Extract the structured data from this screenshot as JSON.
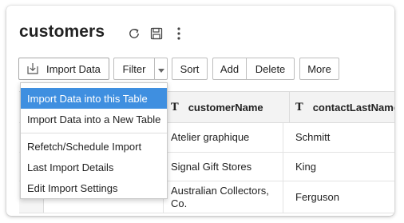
{
  "page": {
    "title": "customers"
  },
  "title_icons": [
    "refresh-icon",
    "save-icon",
    "more-vertical-icon"
  ],
  "toolbar": {
    "import_label": "Import Data",
    "filter_label": "Filter",
    "sort_label": "Sort",
    "add_label": "Add",
    "delete_label": "Delete",
    "more_label": "More"
  },
  "import_menu": {
    "items": [
      {
        "label": "Import Data into this Table",
        "active": true
      },
      {
        "label": "Import Data into a New Table",
        "active": false
      },
      {
        "label": "Refetch/Schedule Import",
        "active": false
      },
      {
        "label": "Last Import Details",
        "active": false
      },
      {
        "label": "Edit Import Settings",
        "active": false
      }
    ]
  },
  "table": {
    "columns": [
      {
        "type_glyph": "T",
        "name": "customerName"
      },
      {
        "type_glyph": "T",
        "name": "contactLastName"
      }
    ],
    "rows": [
      {
        "customerName": "Atelier graphique",
        "contactLastName": "Schmitt"
      },
      {
        "customerName": "Signal Gift Stores",
        "contactLastName": "King"
      },
      {
        "customerName": "Australian Collectors, Co.",
        "contactLastName": "Ferguson"
      }
    ]
  },
  "colors": {
    "accent": "#3f8fe0",
    "header_bg": "#f3f3f3",
    "border": "#bdbdbd"
  }
}
